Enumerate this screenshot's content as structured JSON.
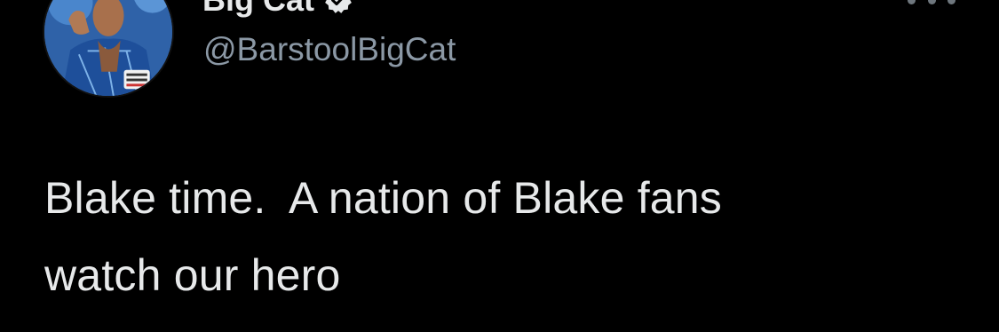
{
  "user": {
    "display_name": "Big Cat",
    "handle": "@BarstoolBigCat",
    "verified": true,
    "avatar_icon": "profile-photo"
  },
  "tweet": {
    "text": "Blake time.  A nation of Blake fans\nwatch our hero"
  },
  "menu": {
    "more_icon": "more-options-icon"
  },
  "colors": {
    "background": "#000000",
    "primary_text": "#e7e9ea",
    "secondary_text": "#8b98a5",
    "verified_badge": "#e7e9ea"
  }
}
